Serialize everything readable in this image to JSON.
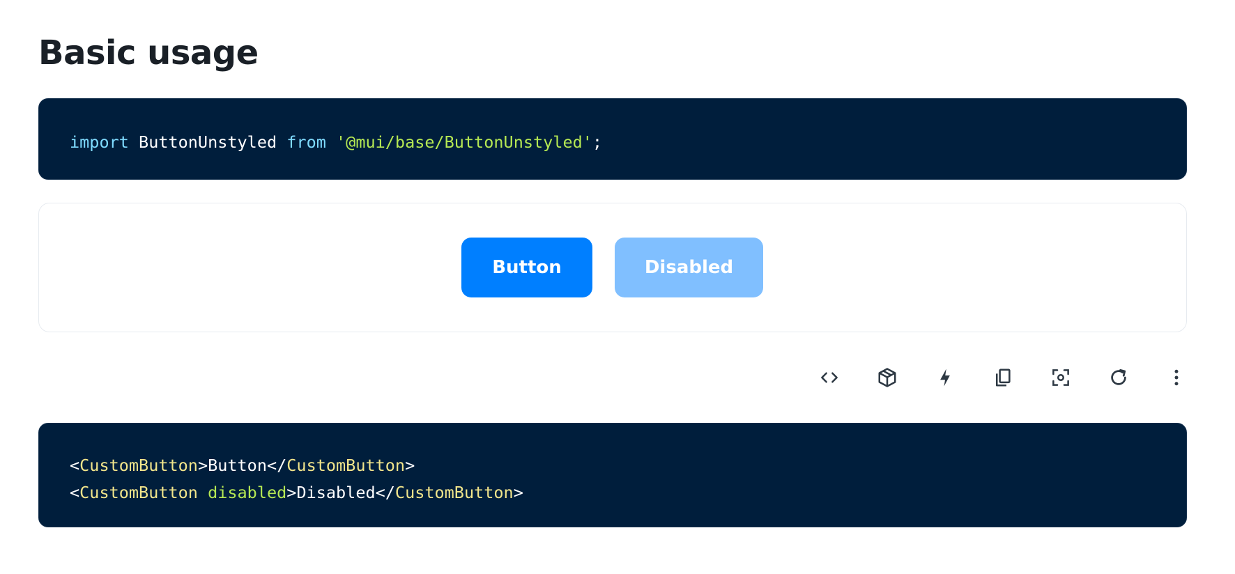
{
  "section": {
    "title": "Basic usage"
  },
  "import_code": {
    "keyword_import": "import",
    "identifier": "ButtonUnstyled",
    "keyword_from": "from",
    "module": "'@mui/base/ButtonUnstyled'",
    "semicolon": ";"
  },
  "demo": {
    "button_label": "Button",
    "disabled_label": "Disabled",
    "primary_color": "#007fff",
    "disabled_color": "#80bfff"
  },
  "toolbar": {
    "icons": [
      "code-icon",
      "codesandbox-icon",
      "stackblitz-icon",
      "copy-icon",
      "reset-focus-icon",
      "reset-demo-icon",
      "more-options-icon"
    ]
  },
  "usage_code": {
    "line1": {
      "open_lt": "<",
      "open_tag": "CustomButton",
      "open_gt": ">",
      "text": "Button",
      "close_lt": "</",
      "close_tag": "CustomButton",
      "close_gt": ">"
    },
    "line2": {
      "open_lt": "<",
      "open_tag": "CustomButton",
      "space": " ",
      "attr": "disabled",
      "open_gt": ">",
      "text": "Disabled",
      "close_lt": "</",
      "close_tag": "CustomButton",
      "close_gt": ">"
    }
  },
  "colors": {
    "code_background": "#001e3c",
    "keyword": "#7fdbff",
    "string": "#b5e853",
    "tag": "#f1e58b"
  }
}
